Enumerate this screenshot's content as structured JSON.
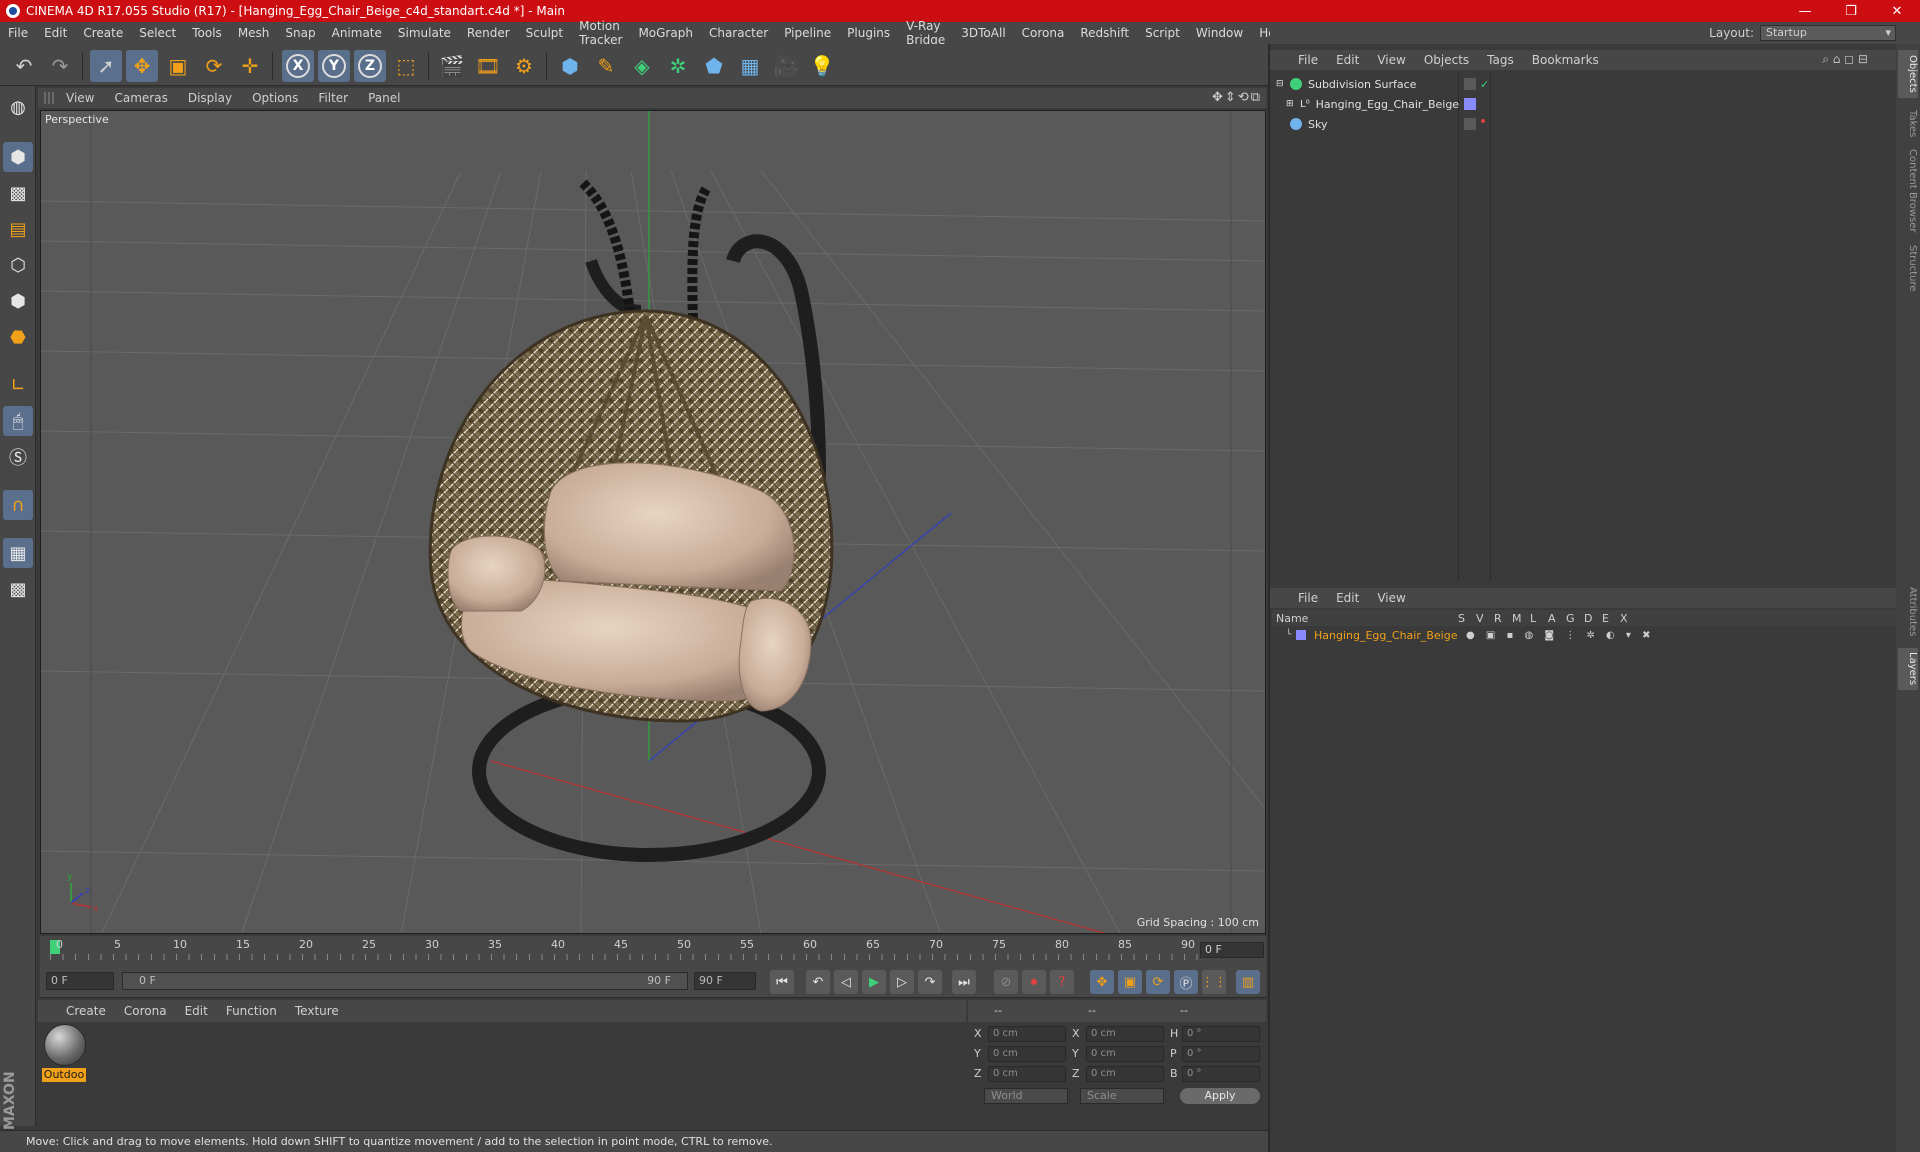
{
  "titlebar": {
    "title": "CINEMA 4D R17.055 Studio (R17) - [Hanging_Egg_Chair_Beige_c4d_standart.c4d *] - Main",
    "minimize": "—",
    "maximize": "❐",
    "close": "✕"
  },
  "menu": [
    "File",
    "Edit",
    "Create",
    "Select",
    "Tools",
    "Mesh",
    "Snap",
    "Animate",
    "Simulate",
    "Render",
    "Sculpt",
    "Motion Tracker",
    "MoGraph",
    "Character",
    "Pipeline",
    "Plugins",
    "V-Ray Bridge",
    "3DToAll",
    "Corona",
    "Redshift",
    "Script",
    "Window",
    "Help"
  ],
  "layout": {
    "label": "Layout:",
    "value": "Startup"
  },
  "viewport": {
    "menu": [
      "View",
      "Cameras",
      "Display",
      "Options",
      "Filter",
      "Panel"
    ],
    "label": "Perspective",
    "grid_spacing": "Grid Spacing : 100 cm",
    "nav_icons": "✥⇕⟲⧉",
    "axis_x": "x",
    "axis_y": "y",
    "axis_z": "z"
  },
  "timeline": {
    "ticks": [
      "0",
      "5",
      "10",
      "15",
      "20",
      "25",
      "30",
      "35",
      "40",
      "45",
      "50",
      "55",
      "60",
      "65",
      "70",
      "75",
      "80",
      "85",
      "90"
    ],
    "current_frame": "0 F",
    "start_field": "0 F",
    "range_start": "0 F",
    "range_end": "90 F",
    "end_field": "90 F"
  },
  "material_manager": {
    "menu": [
      "Create",
      "Corona",
      "Edit",
      "Function",
      "Texture"
    ],
    "material_name": "Outdoo"
  },
  "coordinates": {
    "header": [
      "--",
      "--",
      "--"
    ],
    "rows": [
      {
        "a": "X",
        "av": "0 cm",
        "b": "X",
        "bv": "0 cm",
        "c": "H",
        "cv": "0 °"
      },
      {
        "a": "Y",
        "av": "0 cm",
        "b": "Y",
        "bv": "0 cm",
        "c": "P",
        "cv": "0 °"
      },
      {
        "a": "Z",
        "av": "0 cm",
        "b": "Z",
        "bv": "0 cm",
        "c": "B",
        "cv": "0 °"
      }
    ],
    "mode": "World",
    "transform": "Scale",
    "apply": "Apply"
  },
  "status": "Move: Click and drag to move elements. Hold down SHIFT to quantize movement / add to the selection in point mode, CTRL to remove.",
  "object_manager": {
    "menu": [
      "File",
      "Edit",
      "View",
      "Objects",
      "Tags",
      "Bookmarks"
    ],
    "objects": [
      {
        "name": "Subdivision Surface"
      },
      {
        "name": "Hanging_Egg_Chair_Beige"
      },
      {
        "name": "Sky"
      }
    ]
  },
  "layer_manager": {
    "menu": [
      "File",
      "Edit",
      "View"
    ],
    "columns": [
      "Name",
      "S",
      "V",
      "R",
      "M",
      "L",
      "A",
      "G",
      "D",
      "E",
      "X"
    ],
    "layer_name": "Hanging_Egg_Chair_Beige"
  },
  "side_tabs": [
    "Objects",
    "Takes",
    "Content Browser",
    "Structure",
    "Attributes",
    "Layers"
  ],
  "colors": {
    "accent": "#f0a019",
    "selected": "#5a6f8c",
    "title": "#cc0e13"
  }
}
